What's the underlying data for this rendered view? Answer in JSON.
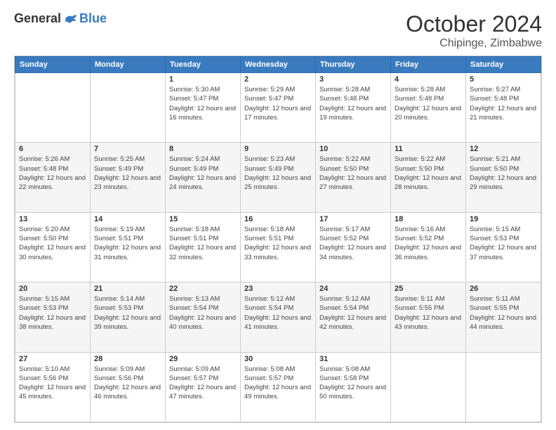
{
  "logo": {
    "general": "General",
    "blue": "Blue"
  },
  "header": {
    "month": "October 2024",
    "location": "Chipinge, Zimbabwe"
  },
  "weekdays": [
    "Sunday",
    "Monday",
    "Tuesday",
    "Wednesday",
    "Thursday",
    "Friday",
    "Saturday"
  ],
  "weeks": [
    [
      {
        "day": "",
        "info": ""
      },
      {
        "day": "",
        "info": ""
      },
      {
        "day": "1",
        "sunrise": "Sunrise: 5:30 AM",
        "sunset": "Sunset: 5:47 PM",
        "daylight": "Daylight: 12 hours and 16 minutes."
      },
      {
        "day": "2",
        "sunrise": "Sunrise: 5:29 AM",
        "sunset": "Sunset: 5:47 PM",
        "daylight": "Daylight: 12 hours and 17 minutes."
      },
      {
        "day": "3",
        "sunrise": "Sunrise: 5:28 AM",
        "sunset": "Sunset: 5:48 PM",
        "daylight": "Daylight: 12 hours and 19 minutes."
      },
      {
        "day": "4",
        "sunrise": "Sunrise: 5:28 AM",
        "sunset": "Sunset: 5:48 PM",
        "daylight": "Daylight: 12 hours and 20 minutes."
      },
      {
        "day": "5",
        "sunrise": "Sunrise: 5:27 AM",
        "sunset": "Sunset: 5:48 PM",
        "daylight": "Daylight: 12 hours and 21 minutes."
      }
    ],
    [
      {
        "day": "6",
        "sunrise": "Sunrise: 5:26 AM",
        "sunset": "Sunset: 5:48 PM",
        "daylight": "Daylight: 12 hours and 22 minutes."
      },
      {
        "day": "7",
        "sunrise": "Sunrise: 5:25 AM",
        "sunset": "Sunset: 5:49 PM",
        "daylight": "Daylight: 12 hours and 23 minutes."
      },
      {
        "day": "8",
        "sunrise": "Sunrise: 5:24 AM",
        "sunset": "Sunset: 5:49 PM",
        "daylight": "Daylight: 12 hours and 24 minutes."
      },
      {
        "day": "9",
        "sunrise": "Sunrise: 5:23 AM",
        "sunset": "Sunset: 5:49 PM",
        "daylight": "Daylight: 12 hours and 25 minutes."
      },
      {
        "day": "10",
        "sunrise": "Sunrise: 5:22 AM",
        "sunset": "Sunset: 5:50 PM",
        "daylight": "Daylight: 12 hours and 27 minutes."
      },
      {
        "day": "11",
        "sunrise": "Sunrise: 5:22 AM",
        "sunset": "Sunset: 5:50 PM",
        "daylight": "Daylight: 12 hours and 28 minutes."
      },
      {
        "day": "12",
        "sunrise": "Sunrise: 5:21 AM",
        "sunset": "Sunset: 5:50 PM",
        "daylight": "Daylight: 12 hours and 29 minutes."
      }
    ],
    [
      {
        "day": "13",
        "sunrise": "Sunrise: 5:20 AM",
        "sunset": "Sunset: 5:50 PM",
        "daylight": "Daylight: 12 hours and 30 minutes."
      },
      {
        "day": "14",
        "sunrise": "Sunrise: 5:19 AM",
        "sunset": "Sunset: 5:51 PM",
        "daylight": "Daylight: 12 hours and 31 minutes."
      },
      {
        "day": "15",
        "sunrise": "Sunrise: 5:18 AM",
        "sunset": "Sunset: 5:51 PM",
        "daylight": "Daylight: 12 hours and 32 minutes."
      },
      {
        "day": "16",
        "sunrise": "Sunrise: 5:18 AM",
        "sunset": "Sunset: 5:51 PM",
        "daylight": "Daylight: 12 hours and 33 minutes."
      },
      {
        "day": "17",
        "sunrise": "Sunrise: 5:17 AM",
        "sunset": "Sunset: 5:52 PM",
        "daylight": "Daylight: 12 hours and 34 minutes."
      },
      {
        "day": "18",
        "sunrise": "Sunrise: 5:16 AM",
        "sunset": "Sunset: 5:52 PM",
        "daylight": "Daylight: 12 hours and 36 minutes."
      },
      {
        "day": "19",
        "sunrise": "Sunrise: 5:15 AM",
        "sunset": "Sunset: 5:53 PM",
        "daylight": "Daylight: 12 hours and 37 minutes."
      }
    ],
    [
      {
        "day": "20",
        "sunrise": "Sunrise: 5:15 AM",
        "sunset": "Sunset: 5:53 PM",
        "daylight": "Daylight: 12 hours and 38 minutes."
      },
      {
        "day": "21",
        "sunrise": "Sunrise: 5:14 AM",
        "sunset": "Sunset: 5:53 PM",
        "daylight": "Daylight: 12 hours and 39 minutes."
      },
      {
        "day": "22",
        "sunrise": "Sunrise: 5:13 AM",
        "sunset": "Sunset: 5:54 PM",
        "daylight": "Daylight: 12 hours and 40 minutes."
      },
      {
        "day": "23",
        "sunrise": "Sunrise: 5:12 AM",
        "sunset": "Sunset: 5:54 PM",
        "daylight": "Daylight: 12 hours and 41 minutes."
      },
      {
        "day": "24",
        "sunrise": "Sunrise: 5:12 AM",
        "sunset": "Sunset: 5:54 PM",
        "daylight": "Daylight: 12 hours and 42 minutes."
      },
      {
        "day": "25",
        "sunrise": "Sunrise: 5:11 AM",
        "sunset": "Sunset: 5:55 PM",
        "daylight": "Daylight: 12 hours and 43 minutes."
      },
      {
        "day": "26",
        "sunrise": "Sunrise: 5:11 AM",
        "sunset": "Sunset: 5:55 PM",
        "daylight": "Daylight: 12 hours and 44 minutes."
      }
    ],
    [
      {
        "day": "27",
        "sunrise": "Sunrise: 5:10 AM",
        "sunset": "Sunset: 5:56 PM",
        "daylight": "Daylight: 12 hours and 45 minutes."
      },
      {
        "day": "28",
        "sunrise": "Sunrise: 5:09 AM",
        "sunset": "Sunset: 5:56 PM",
        "daylight": "Daylight: 12 hours and 46 minutes."
      },
      {
        "day": "29",
        "sunrise": "Sunrise: 5:09 AM",
        "sunset": "Sunset: 5:57 PM",
        "daylight": "Daylight: 12 hours and 47 minutes."
      },
      {
        "day": "30",
        "sunrise": "Sunrise: 5:08 AM",
        "sunset": "Sunset: 5:57 PM",
        "daylight": "Daylight: 12 hours and 49 minutes."
      },
      {
        "day": "31",
        "sunrise": "Sunrise: 5:08 AM",
        "sunset": "Sunset: 5:58 PM",
        "daylight": "Daylight: 12 hours and 50 minutes."
      },
      {
        "day": "",
        "info": ""
      },
      {
        "day": "",
        "info": ""
      }
    ]
  ]
}
